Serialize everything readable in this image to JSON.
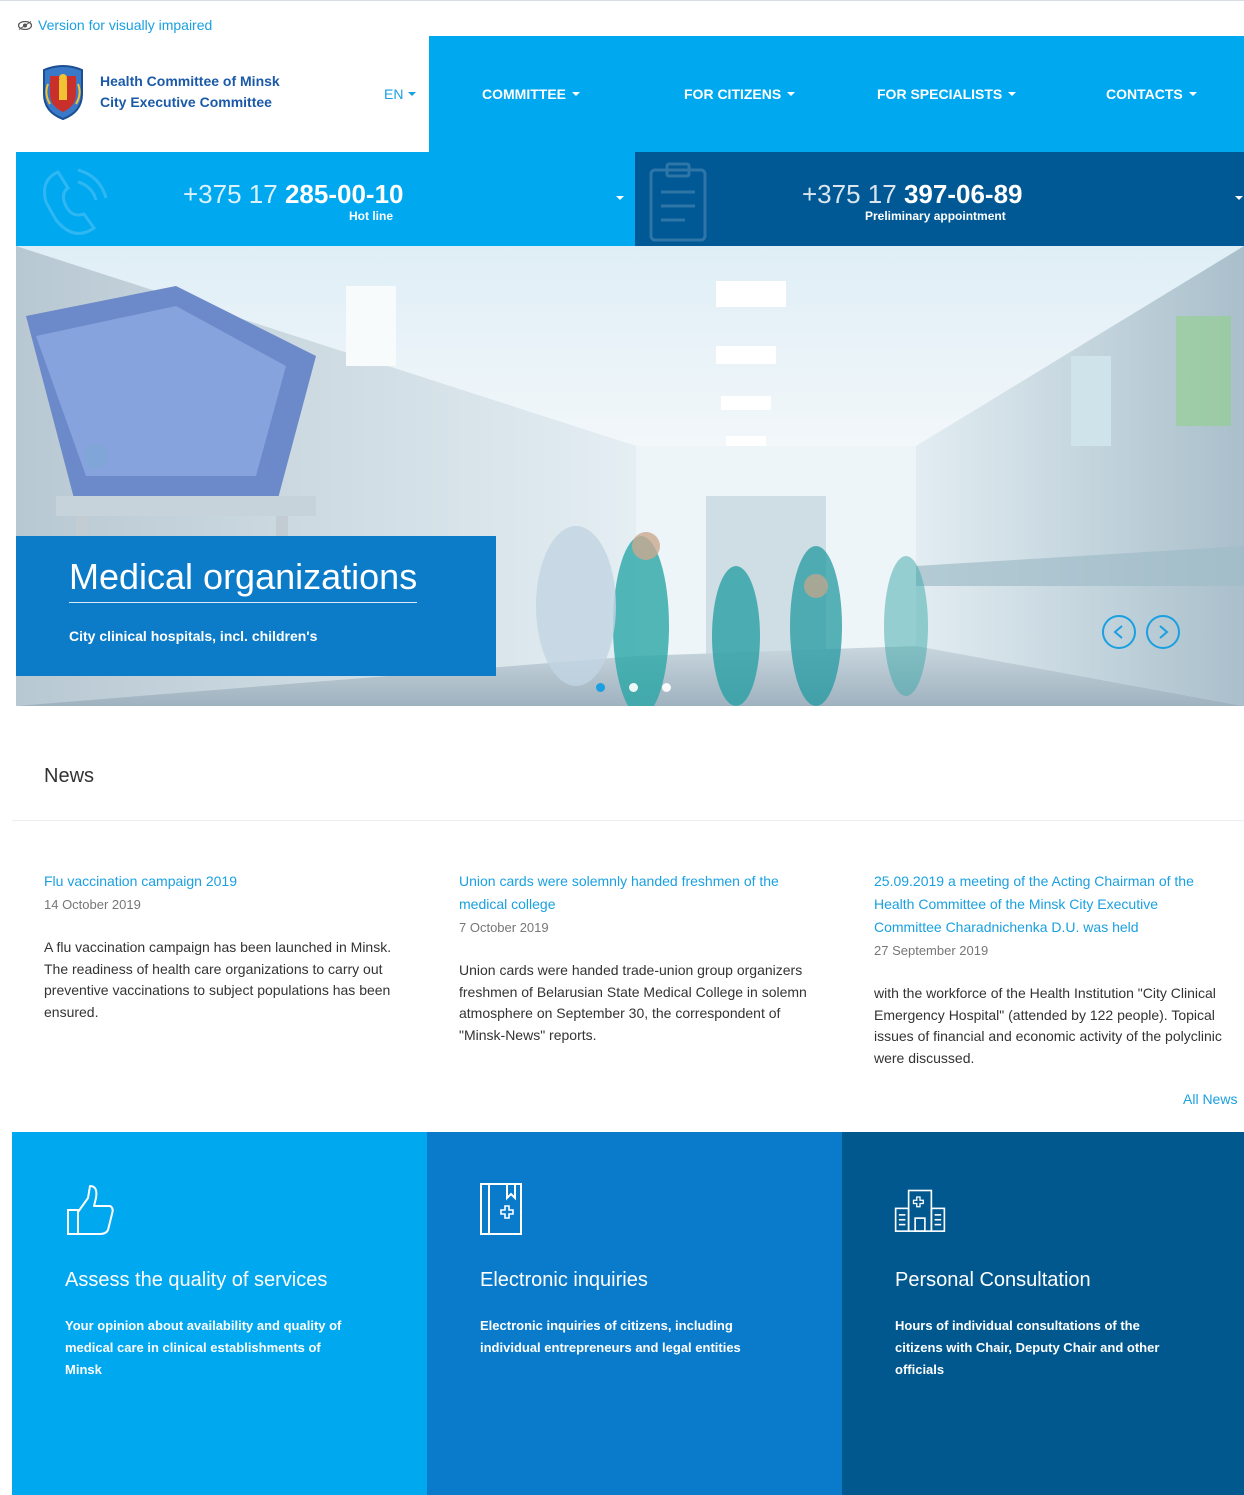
{
  "topbar": {
    "vi_label": "Version for visually impaired"
  },
  "header": {
    "org_line1": "Health Committee of Minsk",
    "org_line2": "City Executive Committee",
    "lang": "EN",
    "nav": [
      {
        "label": "COMMITTEE"
      },
      {
        "label": "FOR CITIZENS"
      },
      {
        "label": "FOR SPECIALISTS"
      },
      {
        "label": "CONTACTS"
      }
    ]
  },
  "phones": [
    {
      "prefix": "+375 17",
      "number": "285-00-10",
      "label": "Hot line",
      "icon": "phone-icon"
    },
    {
      "prefix": "+375 17",
      "number": "397-06-89",
      "label": "Preliminary appointment",
      "icon": "clipboard-icon"
    }
  ],
  "hero": {
    "title": "Medical organizations",
    "subtitle": "City clinical hospitals, incl. children's",
    "slide_count": 3,
    "active_slide": 1
  },
  "news": {
    "heading": "News",
    "all_label": "All News",
    "items": [
      {
        "title": "Flu vaccination campaign 2019",
        "date": "14 October 2019",
        "text": "A flu vaccination campaign has been launched in Minsk. The readiness of health care organizations to carry out preventive vaccinations to subject populations has been ensured."
      },
      {
        "title": "Union cards were solemnly handed freshmen of the medical college",
        "date": "7 October 2019",
        "text": "Union cards were handed trade-union group organizers freshmen of Belarusian State Medical College in solemn atmosphere on September 30, the correspondent of \"Minsk-News\" reports."
      },
      {
        "title": "25.09.2019 a meeting of the Acting Chairman of the Health Committee of the Minsk City Executive Committee Charadnichenka D.U. was held",
        "date": "27 September 2019",
        "text": "with the workforce of the Health Institution \"City Clinical Emergency Hospital\" (attended by 122 people). Topical issues of financial and economic activity of the polyclinic were discussed."
      }
    ]
  },
  "tiles": [
    {
      "title": "Assess the quality of services",
      "text": "Your opinion about availability and quality of medical care in clinical establishments of Minsk",
      "icon": "thumbs-up-icon",
      "color": "#00a8f0"
    },
    {
      "title": "Electronic inquiries",
      "text": "Electronic inquiries of citizens, including individual entrepreneurs and legal entities",
      "icon": "medical-book-icon",
      "color": "#0a7bcb"
    },
    {
      "title": "Personal Consultation",
      "text": "Hours of individual consultations of the citizens with Chair, Deputy Chair and other officials",
      "icon": "hospital-building-icon",
      "color": "#00588f"
    }
  ],
  "colors": {
    "accent": "#00a8f0",
    "dark_blue": "#005895",
    "mid_blue": "#0c7cc9",
    "link": "#1aa0e0"
  }
}
